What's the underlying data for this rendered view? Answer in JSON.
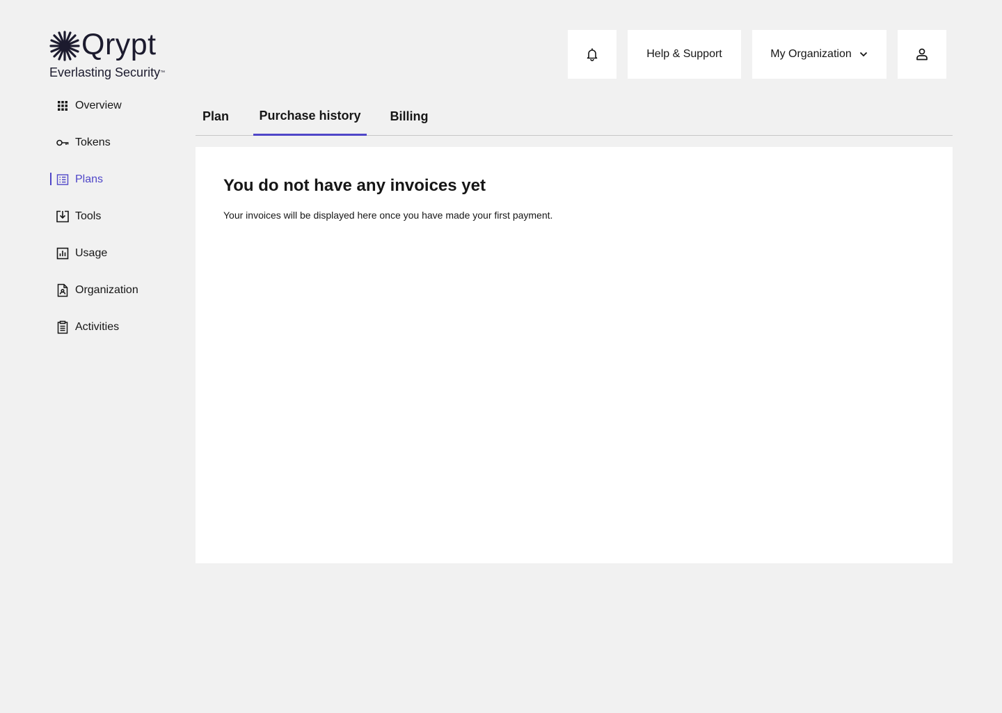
{
  "brand": {
    "name": "Qrypt",
    "tagline": "Everlasting Security",
    "trademark": "™",
    "color": "#1c1b2e"
  },
  "header": {
    "notifications": {
      "icon": "bell-icon"
    },
    "help_label": "Help & Support",
    "org_label": "My Organization",
    "org_icon": "chevron-down-icon",
    "user": {
      "icon": "user-icon"
    }
  },
  "sidebar": {
    "active_color": "#4f46c8",
    "items": [
      {
        "label": "Overview",
        "icon": "grid-icon",
        "active": false
      },
      {
        "label": "Tokens",
        "icon": "key-icon",
        "active": false
      },
      {
        "label": "Plans",
        "icon": "list-icon",
        "active": true
      },
      {
        "label": "Tools",
        "icon": "download-icon",
        "active": false
      },
      {
        "label": "Usage",
        "icon": "bar-chart-icon",
        "active": false
      },
      {
        "label": "Organization",
        "icon": "user-document-icon",
        "active": false
      },
      {
        "label": "Activities",
        "icon": "clipboard-icon",
        "active": false
      }
    ]
  },
  "tabs": [
    {
      "label": "Plan",
      "active": false
    },
    {
      "label": "Purchase history",
      "active": true
    },
    {
      "label": "Billing",
      "active": false
    }
  ],
  "main": {
    "empty_title": "You do not have any invoices yet",
    "empty_description": "Your invoices will be displayed here once you have made your first payment."
  }
}
